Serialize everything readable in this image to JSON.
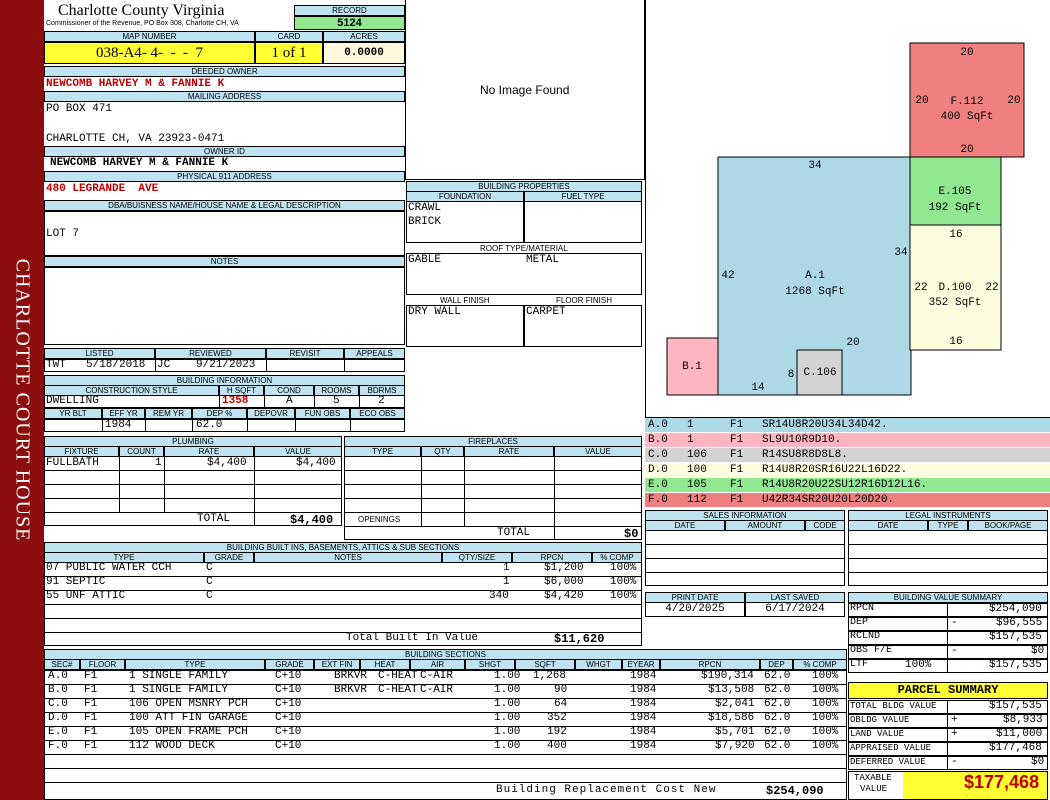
{
  "sidebar": {
    "label": "CHARLOTTE COURT HOUSE"
  },
  "header": {
    "title": "Charlotte County Virginia",
    "subtitle": "Commissioner of the Revenue, PO Box 308, Charlotte CH, VA",
    "record_label": "RECORD",
    "record": "5124"
  },
  "card": {
    "map_label": "MAP NUMBER",
    "map_number": "038-A4- 4-  -  -  7",
    "card_label": "CARD",
    "card": "1 of 1",
    "acres_label": "ACRES",
    "acres": "0.0000"
  },
  "owner": {
    "deeded_label": "DEEDED OWNER",
    "deeded": "NEWCOMB HARVEY M & FANNIE K",
    "mailing_label": "MAILING ADDRESS",
    "mail1": "PO BOX 471",
    "mail2": "CHARLOTTE CH, VA 23923-0471",
    "ownerid_label": "OWNER ID",
    "ownerid": "NEWCOMB HARVEY M & FANNIE K",
    "physical_label": "PHYSICAL 911 ADDRESS",
    "physical": "480 LEGRANDE  AVE",
    "dba_label": "DBA/BUISNESS NAME/HOUSE NAME & LEGAL DESCRIPTION",
    "legal": "LOT 7",
    "notes_label": "NOTES"
  },
  "image": {
    "placeholder": "No Image Found"
  },
  "review": {
    "listed_label": "LISTED",
    "listed_by": "TWT",
    "listed_date": "5/18/2018",
    "reviewed_label": "REVIEWED",
    "reviewed_by": "JC",
    "reviewed_date": "9/21/2023",
    "revisit_label": "REVISIT",
    "appeals_label": "APPEALS"
  },
  "building_info": {
    "title": "BUILDING INFORMATION",
    "construction_label": "CONSTRUCTION STYLE",
    "hsqft_label": "H SQFT",
    "cond_label": "COND",
    "rooms_label": "ROOMS",
    "bdrms_label": "BDRMS",
    "construction": "DWELLING",
    "hsqft": "1358",
    "cond": "A",
    "rooms": "5",
    "bdrms": "2",
    "yrblt_label": "YR BLT",
    "effyr_label": "EFF YR",
    "remyr_label": "REM YR",
    "dep_label": "DEP %",
    "depovr_label": "DEPOVR",
    "funobs_label": "FUN OBS",
    "ecoobs_label": "ECO OBS",
    "effyr": "1984",
    "dep": "62.0"
  },
  "properties": {
    "title": "BUILDING PROPERTIES",
    "foundation_label": "FOUNDATION",
    "fuel_label": "FUEL TYPE",
    "foundation1": "CRAWL",
    "foundation2": "BRICK",
    "roof_label": "ROOF TYPE/MATERIAL",
    "roof_type": "GABLE",
    "roof_material": "METAL",
    "wall_label": "WALL FINISH",
    "floor_label": "FLOOR FINISH",
    "wall": "DRY WALL",
    "floor": "CARPET"
  },
  "plumbing": {
    "title": "PLUMBING",
    "cols": [
      "FIXTURE",
      "COUNT",
      "RATE",
      "VALUE"
    ],
    "rows": [
      [
        "FULLBATH",
        "1",
        "$4,400",
        "$4,400"
      ]
    ],
    "total_label": "TOTAL",
    "total": "$4,400"
  },
  "fireplaces": {
    "title": "FIREPLACES",
    "cols": [
      "TYPE",
      "QTY",
      "RATE",
      "VALUE"
    ],
    "openings_label": "OPENINGS",
    "total_label": "TOTAL",
    "total": "$0"
  },
  "builtins": {
    "title": "BUILDING BUILT INS, BASEMENTS, ATTICS & SUB SECTIONS",
    "cols": [
      "TYPE",
      "GRADE",
      "NOTES",
      "QTY/SIZE",
      "RPCN",
      "% COMP"
    ],
    "rows": [
      [
        "07 PUBLIC WATER CCH",
        "C",
        "",
        "1",
        "$1,200",
        "100%"
      ],
      [
        "91 SEPTIC",
        "C",
        "",
        "1",
        "$6,000",
        "100%"
      ],
      [
        "55 UNF ATTIC",
        "C",
        "",
        "340",
        "$4,420",
        "100%"
      ]
    ],
    "total_label": "Total Built In Value",
    "total": "$11,620"
  },
  "sections": {
    "title": "BUILDING SECTIONS",
    "cols": [
      "SEC#",
      "FLOOR",
      "TYPE",
      "GRADE",
      "EXT FIN",
      "HEAT",
      "AIR",
      "SHGT",
      "SQFT",
      "WHGT",
      "EYEAR",
      "RPCN",
      "DEP",
      "% COMP"
    ],
    "rows": [
      [
        "A.0",
        "F1",
        "1 SINGLE FAMILY",
        "C+10",
        "BRKVR",
        "C-HEAT",
        "C-AIR",
        "1.00",
        "1,268",
        "",
        "1984",
        "$190,314",
        "62.0",
        "100%"
      ],
      [
        "B.0",
        "F1",
        "1 SINGLE FAMILY",
        "C+10",
        "BRKVR",
        "C-HEAT",
        "C-AIR",
        "1.00",
        "90",
        "",
        "1984",
        "$13,508",
        "62.0",
        "100%"
      ],
      [
        "C.0",
        "F1",
        "106 OPEN MSNRY PCH",
        "C+10",
        "",
        "",
        "",
        "1.00",
        "64",
        "",
        "1984",
        "$2,041",
        "62.0",
        "100%"
      ],
      [
        "D.0",
        "F1",
        "100 ATT FIN GARAGE",
        "C+10",
        "",
        "",
        "",
        "1.00",
        "352",
        "",
        "1984",
        "$18,586",
        "62.0",
        "100%"
      ],
      [
        "E.0",
        "F1",
        "105 OPEN FRAME PCH",
        "C+10",
        "",
        "",
        "",
        "1.00",
        "192",
        "",
        "1984",
        "$5,701",
        "62.0",
        "100%"
      ],
      [
        "F.0",
        "F1",
        "112 WOOD DECK",
        "C+10",
        "",
        "",
        "",
        "1.00",
        "400",
        "",
        "1984",
        "$7,920",
        "62.0",
        "100%"
      ]
    ],
    "replacement_label": "Building Replacement Cost New",
    "replacement": "$254,090"
  },
  "sketch": {
    "sections": [
      {
        "id": "F.112",
        "area": "400 SqFt",
        "color": "#f08080"
      },
      {
        "id": "E.105",
        "area": "192 SqFt",
        "color": "#90e890"
      },
      {
        "id": "A.1",
        "area": "1268 SqFt",
        "color": "#add8e6"
      },
      {
        "id": "D.100",
        "area": "352 SqFt",
        "color": "#fffde0"
      },
      {
        "id": "B.1",
        "area": "",
        "color": "#ffb6c1"
      },
      {
        "id": "C.106",
        "area": "",
        "color": "#d3d3d3"
      }
    ],
    "dims": [
      "20",
      "20",
      "20",
      "20",
      "34",
      "34",
      "16",
      "42",
      "22",
      "22",
      "16",
      "20",
      "14",
      "8"
    ]
  },
  "legend": {
    "rows": [
      [
        "A.0",
        "1",
        "F1",
        "SR14U8R20U34L34D42."
      ],
      [
        "B.0",
        "1",
        "F1",
        "SL9U10R9D10."
      ],
      [
        "C.0",
        "106",
        "F1",
        "R14SU8R8D8L8."
      ],
      [
        "D.0",
        "100",
        "F1",
        "R14U8R20SR16U22L16D22."
      ],
      [
        "E.0",
        "105",
        "F1",
        "R14U8R20U22SU12R16D12L16."
      ],
      [
        "F.0",
        "112",
        "F1",
        "U42R34SR20U20L20D20."
      ]
    ],
    "colors": [
      "#add8e6",
      "#ffb6c1",
      "#d3d3d3",
      "#fffde0",
      "#90e890",
      "#f08080"
    ]
  },
  "sales": {
    "title": "SALES INFORMATION",
    "cols": [
      "DATE",
      "AMOUNT",
      "CODE"
    ]
  },
  "legal": {
    "title": "LEGAL INSTRUMENTS",
    "cols": [
      "DATE",
      "TYPE",
      "BOOK/PAGE"
    ]
  },
  "dates": {
    "print_label": "PRINT DATE",
    "print": "4/20/2025",
    "saved_label": "LAST SAVED",
    "saved": "6/17/2024"
  },
  "value_summary": {
    "title": "BUILDING VALUE SUMMARY",
    "rows": [
      [
        "RPCN",
        "",
        "$254,090"
      ],
      [
        "DEP",
        "-",
        "$96,555"
      ],
      [
        "RCLND",
        "",
        "$157,535"
      ],
      [
        "OBS F/E",
        "-",
        "$0"
      ],
      [
        "LTF",
        "100%",
        "$157,535"
      ]
    ]
  },
  "parcel": {
    "title": "PARCEL SUMMARY",
    "rows": [
      [
        "TOTAL BLDG VALUE",
        "",
        "$157,535"
      ],
      [
        "OBLDG VALUE",
        "+",
        "$8,933"
      ],
      [
        "LAND VALUE",
        "+",
        "$11,000"
      ],
      [
        "APPRAISED VALUE",
        "",
        "$177,468"
      ],
      [
        "DEFERRED VALUE",
        "-",
        "$0"
      ]
    ],
    "taxable_label1": "TAXABLE",
    "taxable_label2": "VALUE",
    "taxable": "$177,468"
  }
}
